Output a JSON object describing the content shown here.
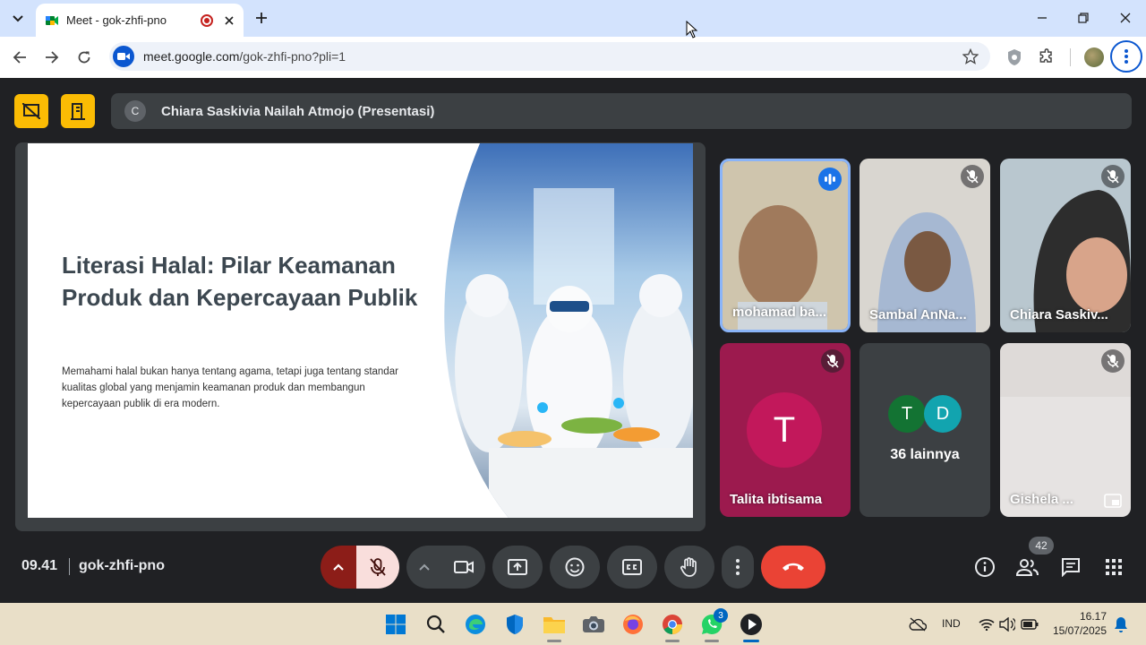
{
  "browser": {
    "tab": {
      "title": "Meet - gok-zhfi-pno"
    },
    "url": {
      "host": "meet.google.com",
      "path": "/gok-zhfi-pno?pli=1"
    }
  },
  "meet": {
    "presenter": {
      "initial": "C",
      "label": "Chiara Saskivia Nailah Atmojo (Presentasi)"
    },
    "slide": {
      "title": "Literasi Halal: Pilar Keamanan Produk dan Kepercayaan Publik",
      "body": "Memahami halal bukan hanya tentang agama, tetapi juga tentang standar kualitas global yang menjamin keamanan produk dan membangun kepercayaan publik di era modern."
    },
    "participants": [
      {
        "name": "mohamad ba...",
        "state": "speaking"
      },
      {
        "name": "Sambal AnNa...",
        "state": "muted"
      },
      {
        "name": "Chiara Saskiv...",
        "state": "muted"
      },
      {
        "name": "Talita ibtisama",
        "initial": "T",
        "state": "muted",
        "avatar_color": "#c2185b"
      },
      {
        "others": [
          {
            "initial": "T",
            "color": "#137333"
          },
          {
            "initial": "D",
            "color": "#12a4af"
          }
        ],
        "more_label": "36 lainnya"
      },
      {
        "name": "Gishela ...",
        "state": "muted"
      }
    ],
    "bottom_bar": {
      "time": "09.41",
      "meeting_code": "gok-zhfi-pno",
      "people_count": "42"
    }
  },
  "taskbar": {
    "whatsapp_badge": "3",
    "language": "IND",
    "time": "16.17",
    "date": "15/07/2025"
  },
  "colors": {
    "accent": "#0b57d0",
    "meet_bg": "#202124",
    "hangup": "#ea4335",
    "presentation_btn": "#fbbc04"
  }
}
